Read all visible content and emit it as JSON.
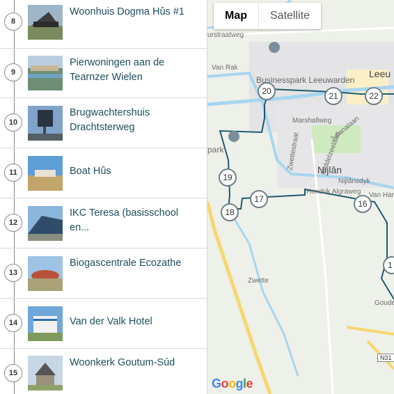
{
  "items": [
    {
      "number": "8",
      "title": "Woonhuis Dogma Hûs #1"
    },
    {
      "number": "9",
      "title": "Pierwoningen aan de Tearnzer Wielen"
    },
    {
      "number": "10",
      "title": "Brugwachtershuis Drachtsterweg"
    },
    {
      "number": "11",
      "title": "Boat Hûs"
    },
    {
      "number": "12",
      "title": "IKC Teresa (basisschool en..."
    },
    {
      "number": "13",
      "title": "Biogascentrale Ecozathe"
    },
    {
      "number": "14",
      "title": "Van der Valk Hotel"
    },
    {
      "number": "15",
      "title": "Woonkerk Goutum-Súd"
    }
  ],
  "map": {
    "map_label": "Map",
    "satellite_label": "Satellite",
    "markers": [
      "20",
      "21",
      "22",
      "19",
      "18",
      "17",
      "16",
      "1"
    ],
    "labels": {
      "businesspark": "Businesspark Leeuwarden",
      "leeuwarden": "Leeu",
      "park": "park",
      "nijlan": "Nijlân",
      "road_top": "urstraatweg",
      "marshallweg": "Marshallweg",
      "zwettestraat": "Zwettestraat",
      "julianalaan": "Julianalaan",
      "middelzeelaan": "Middelzeelaan",
      "nijlansdyk": "Nijlânsdyk",
      "hendrik": "Hendrik Algraweg",
      "vanharinx": "Van Harin",
      "rak": "Van Rak",
      "zwette": "Zwette",
      "gouden": "Goude Ø",
      "n31": "N31"
    },
    "google_logo": "Google",
    "colors": {
      "route": "#1d5a6e",
      "water": "#a7d6ef",
      "road": "#f7d66b",
      "park": "#cfe9c1"
    }
  }
}
